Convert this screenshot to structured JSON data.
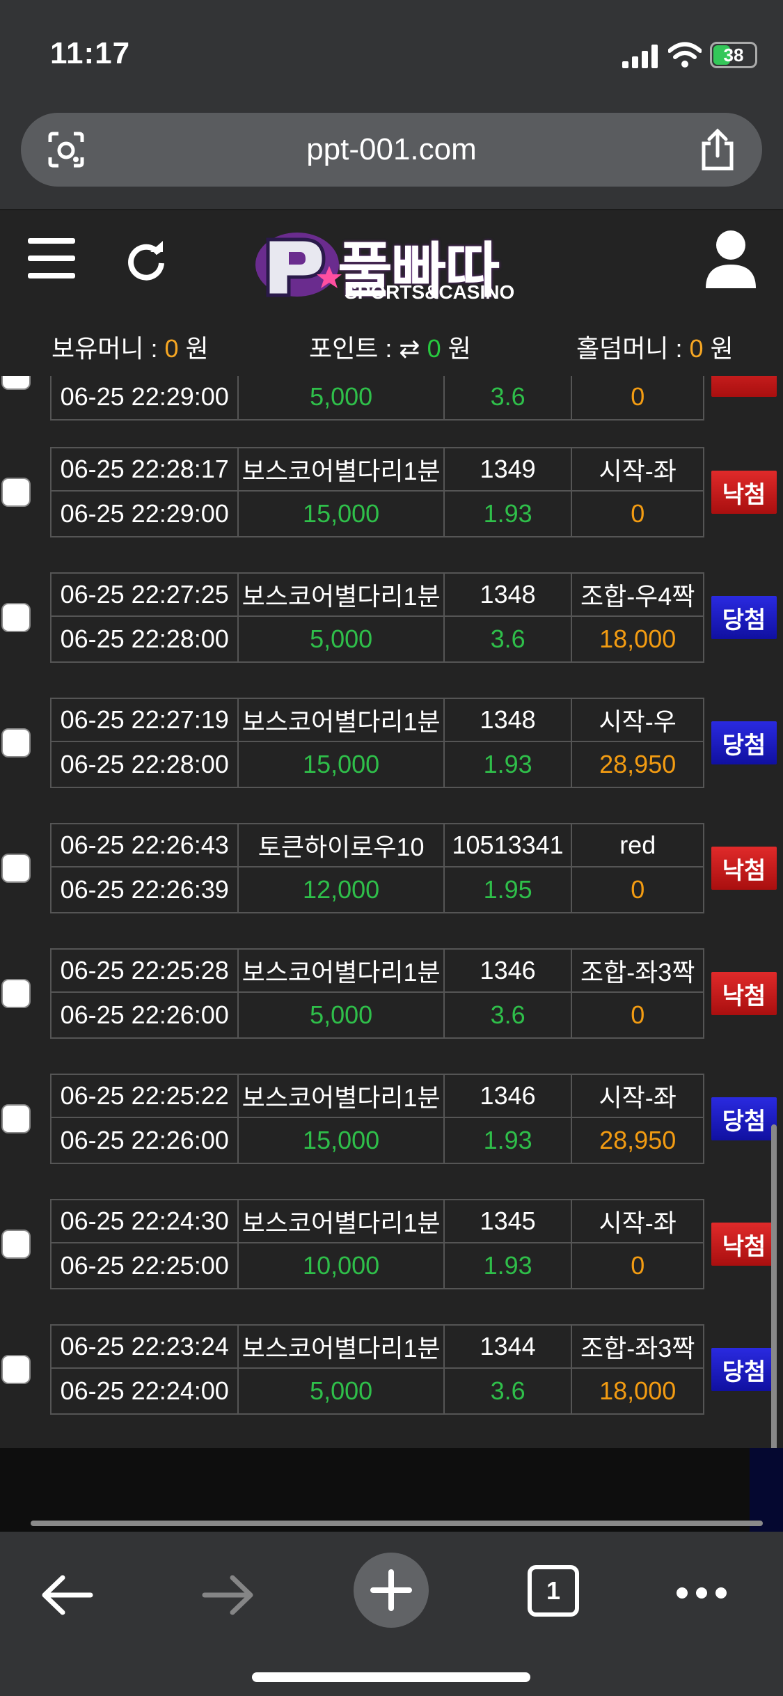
{
  "status_bar": {
    "time": "11:17",
    "battery": "38"
  },
  "browser": {
    "url": "ppt-001.com",
    "tabs_count": "1"
  },
  "site": {
    "logo_text": "풀빠따",
    "logo_sub": "SPORTS&CASINO",
    "balances": {
      "money_label": "보유머니 : ",
      "money_value": "0",
      "money_unit": " 원",
      "point_label": "포인트 : ",
      "point_value": "0",
      "point_unit": " 원",
      "holdem_label": "홀덤머니 : ",
      "holdem_value": "0",
      "holdem_unit": " 원"
    }
  },
  "bets": [
    {
      "bet_time": "",
      "game": "",
      "round": "",
      "pick": "",
      "close_time": "06-25 22:29:00",
      "amount": "5,000",
      "odds": "3.6",
      "payout": "0",
      "status": "",
      "status_type": "lose"
    },
    {
      "bet_time": "06-25 22:28:17",
      "game": "보스코어별다리1분",
      "round": "1349",
      "pick": "시작-좌",
      "close_time": "06-25 22:29:00",
      "amount": "15,000",
      "odds": "1.93",
      "payout": "0",
      "status": "낙첨",
      "status_type": "lose"
    },
    {
      "bet_time": "06-25 22:27:25",
      "game": "보스코어별다리1분",
      "round": "1348",
      "pick": "조합-우4짝",
      "close_time": "06-25 22:28:00",
      "amount": "5,000",
      "odds": "3.6",
      "payout": "18,000",
      "status": "당첨",
      "status_type": "win"
    },
    {
      "bet_time": "06-25 22:27:19",
      "game": "보스코어별다리1분",
      "round": "1348",
      "pick": "시작-우",
      "close_time": "06-25 22:28:00",
      "amount": "15,000",
      "odds": "1.93",
      "payout": "28,950",
      "status": "당첨",
      "status_type": "win"
    },
    {
      "bet_time": "06-25 22:26:43",
      "game": "토큰하이로우10",
      "round": "10513341",
      "pick": "red",
      "close_time": "06-25 22:26:39",
      "amount": "12,000",
      "odds": "1.95",
      "payout": "0",
      "status": "낙첨",
      "status_type": "lose"
    },
    {
      "bet_time": "06-25 22:25:28",
      "game": "보스코어별다리1분",
      "round": "1346",
      "pick": "조합-좌3짝",
      "close_time": "06-25 22:26:00",
      "amount": "5,000",
      "odds": "3.6",
      "payout": "0",
      "status": "낙첨",
      "status_type": "lose"
    },
    {
      "bet_time": "06-25 22:25:22",
      "game": "보스코어별다리1분",
      "round": "1346",
      "pick": "시작-좌",
      "close_time": "06-25 22:26:00",
      "amount": "15,000",
      "odds": "1.93",
      "payout": "28,950",
      "status": "당첨",
      "status_type": "win"
    },
    {
      "bet_time": "06-25 22:24:30",
      "game": "보스코어별다리1분",
      "round": "1345",
      "pick": "시작-좌",
      "close_time": "06-25 22:25:00",
      "amount": "10,000",
      "odds": "1.93",
      "payout": "0",
      "status": "낙첨",
      "status_type": "lose"
    },
    {
      "bet_time": "06-25 22:23:24",
      "game": "보스코어별다리1분",
      "round": "1344",
      "pick": "조합-좌3짝",
      "close_time": "06-25 22:24:00",
      "amount": "5,000",
      "odds": "3.6",
      "payout": "18,000",
      "status": "당첨",
      "status_type": "win"
    }
  ],
  "colors": {
    "win": "#2020c8",
    "lose": "#c81a1a",
    "amount": "#2fbf4a",
    "payout": "#f39c12"
  },
  "icons": [
    "camera-lens-icon",
    "share-icon",
    "menu-icon",
    "refresh-icon",
    "user-icon",
    "transfer-icon",
    "back-icon",
    "forward-icon",
    "plus-icon",
    "tabs-icon",
    "more-icon"
  ]
}
